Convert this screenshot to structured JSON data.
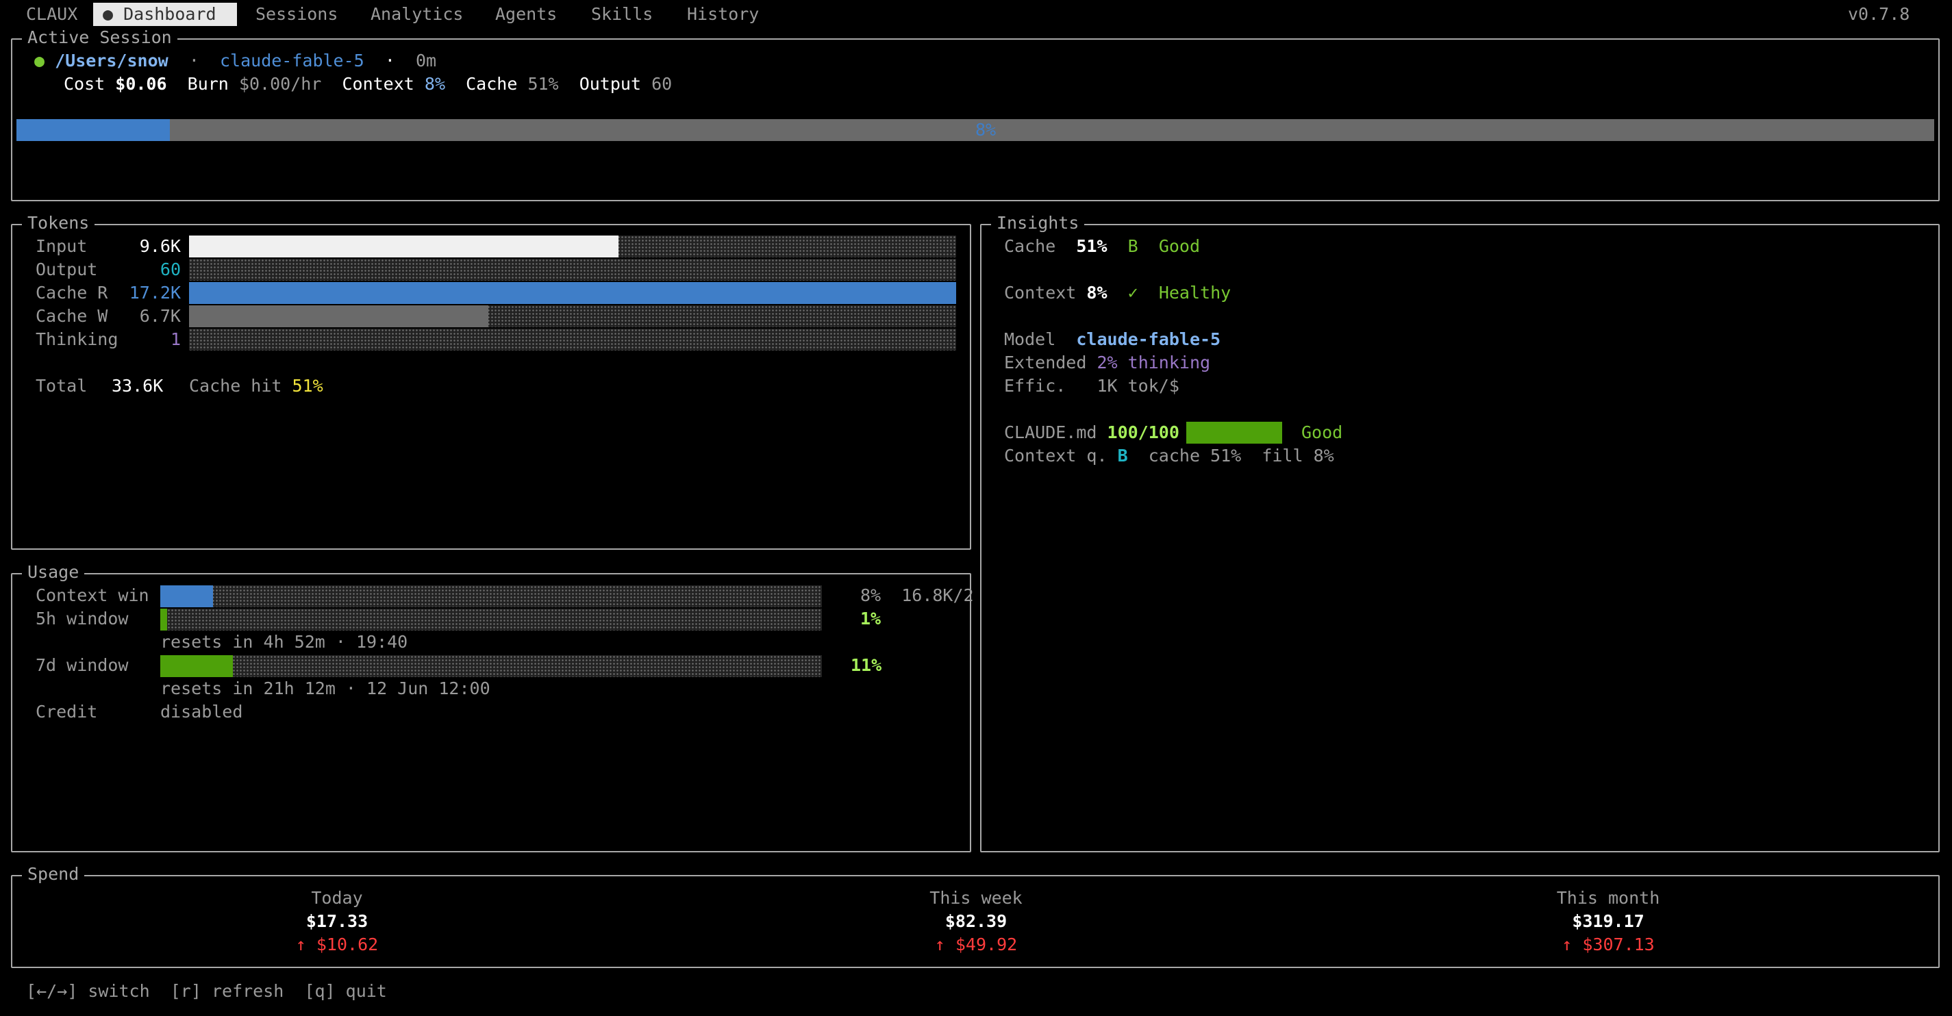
{
  "app": {
    "name": "CLAUX",
    "version": "v0.7.8",
    "tabs": [
      {
        "label": "● Dashboard",
        "active": true
      },
      {
        "label": "Sessions",
        "active": false
      },
      {
        "label": "Analytics",
        "active": false
      },
      {
        "label": "Agents",
        "active": false
      },
      {
        "label": "Skills",
        "active": false
      },
      {
        "label": "History",
        "active": false
      }
    ]
  },
  "active_session": {
    "title": "Active Session",
    "status_dot": "●",
    "path": "/Users/snow",
    "sep": "·",
    "model": "claude-fable-5",
    "duration": "0m",
    "cost_label": "Cost",
    "cost_value": "$0.06",
    "burn_label": "Burn",
    "burn_value": "$0.00/hr",
    "context_label": "Context",
    "context_value": "8%",
    "cache_label": "Cache",
    "cache_value": "51%",
    "output_label": "Output",
    "output_value": "60",
    "context_bar_percent": 8,
    "context_bar_text": "8%"
  },
  "tokens": {
    "title": "Tokens",
    "rows": [
      {
        "label": "Input",
        "value": "9.6K",
        "fill": 0.56
      },
      {
        "label": "Output",
        "value": "60",
        "fill": 0.0
      },
      {
        "label": "Cache R",
        "value": "17.2K",
        "fill": 1.0
      },
      {
        "label": "Cache W",
        "value": "6.7K",
        "fill": 0.39
      },
      {
        "label": "Thinking",
        "value": "1",
        "fill": 0.0
      }
    ],
    "total_label": "Total",
    "total_value": "33.6K",
    "cache_hit_label": "Cache hit",
    "cache_hit_value": "51%"
  },
  "insights": {
    "title": "Insights",
    "cache_label": "Cache",
    "cache_value": "51%",
    "cache_grade": "B",
    "cache_status": "Good",
    "context_label": "Context",
    "context_value": "8%",
    "context_check": "✓",
    "context_status": "Healthy",
    "model_label": "Model",
    "model_value": "claude-fable-5",
    "extended_label": "Extended",
    "extended_value": "2%",
    "extended_suffix": "thinking",
    "effic_label": "Effic.",
    "effic_value": "1K tok/$",
    "claude_md_label": "CLAUDE.md",
    "claude_md_score": "100/100",
    "claude_md_fill": 1.0,
    "claude_md_status": "Good",
    "context_q_label": "Context q.",
    "context_q_grade": "B",
    "context_q_cache": "cache 51%",
    "context_q_fill": "fill 8%"
  },
  "usage": {
    "title": "Usage",
    "context_win_label": "Context win",
    "context_win_fill": 0.08,
    "context_win_pct": "8%",
    "context_win_tokens": "16.8K/2",
    "window5_label": "5h window",
    "window5_fill": 0.01,
    "window5_pct": "1%",
    "window5_reset": "resets in 4h 52m · 19:40",
    "window7_label": "7d window",
    "window7_fill": 0.11,
    "window7_pct": "11%",
    "window7_reset": "resets in 21h 12m · 12 Jun 12:00",
    "credit_label": "Credit",
    "credit_value": "disabled"
  },
  "spend": {
    "title": "Spend",
    "periods": [
      {
        "label": "Today",
        "value": "$17.33",
        "delta": "↑ $10.62"
      },
      {
        "label": "This week",
        "value": "$82.39",
        "delta": "↑ $49.92"
      },
      {
        "label": "This month",
        "value": "$319.17",
        "delta": "↑ $307.13"
      }
    ]
  },
  "footer": {
    "switch_key": "[←/→]",
    "switch_label": "switch",
    "refresh_key": "[r]",
    "refresh_label": "refresh",
    "quit_key": "[q]",
    "quit_label": "quit"
  },
  "colors": {
    "blue_bar": "#3f7ec8",
    "green_bar": "#4ea10a",
    "white_bar": "#f0f0f0",
    "gray_bar": "#6a6a6a",
    "border": "#a8a8a8"
  }
}
